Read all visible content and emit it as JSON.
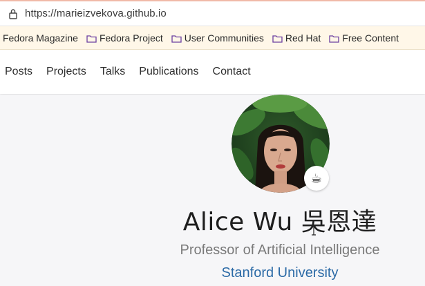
{
  "browser": {
    "url": "https://marieizvekova.github.io",
    "bookmarks": [
      {
        "label": "Fedora Magazine",
        "has_folder": false
      },
      {
        "label": "Fedora Project",
        "has_folder": true
      },
      {
        "label": "User Communities",
        "has_folder": true
      },
      {
        "label": "Red Hat",
        "has_folder": true
      },
      {
        "label": "Free Content",
        "has_folder": true
      }
    ]
  },
  "nav": {
    "items": [
      "Posts",
      "Projects",
      "Talks",
      "Publications",
      "Contact"
    ]
  },
  "profile": {
    "name": "Alice Wu 吳恩達",
    "role": "Professor of Artificial Intelligence",
    "organization": "Stanford University",
    "badge_emoji": "☕"
  },
  "colors": {
    "link": "#2b6aa6",
    "bookmark_bar": "#fff7e8",
    "background": "#f6f6f8"
  }
}
